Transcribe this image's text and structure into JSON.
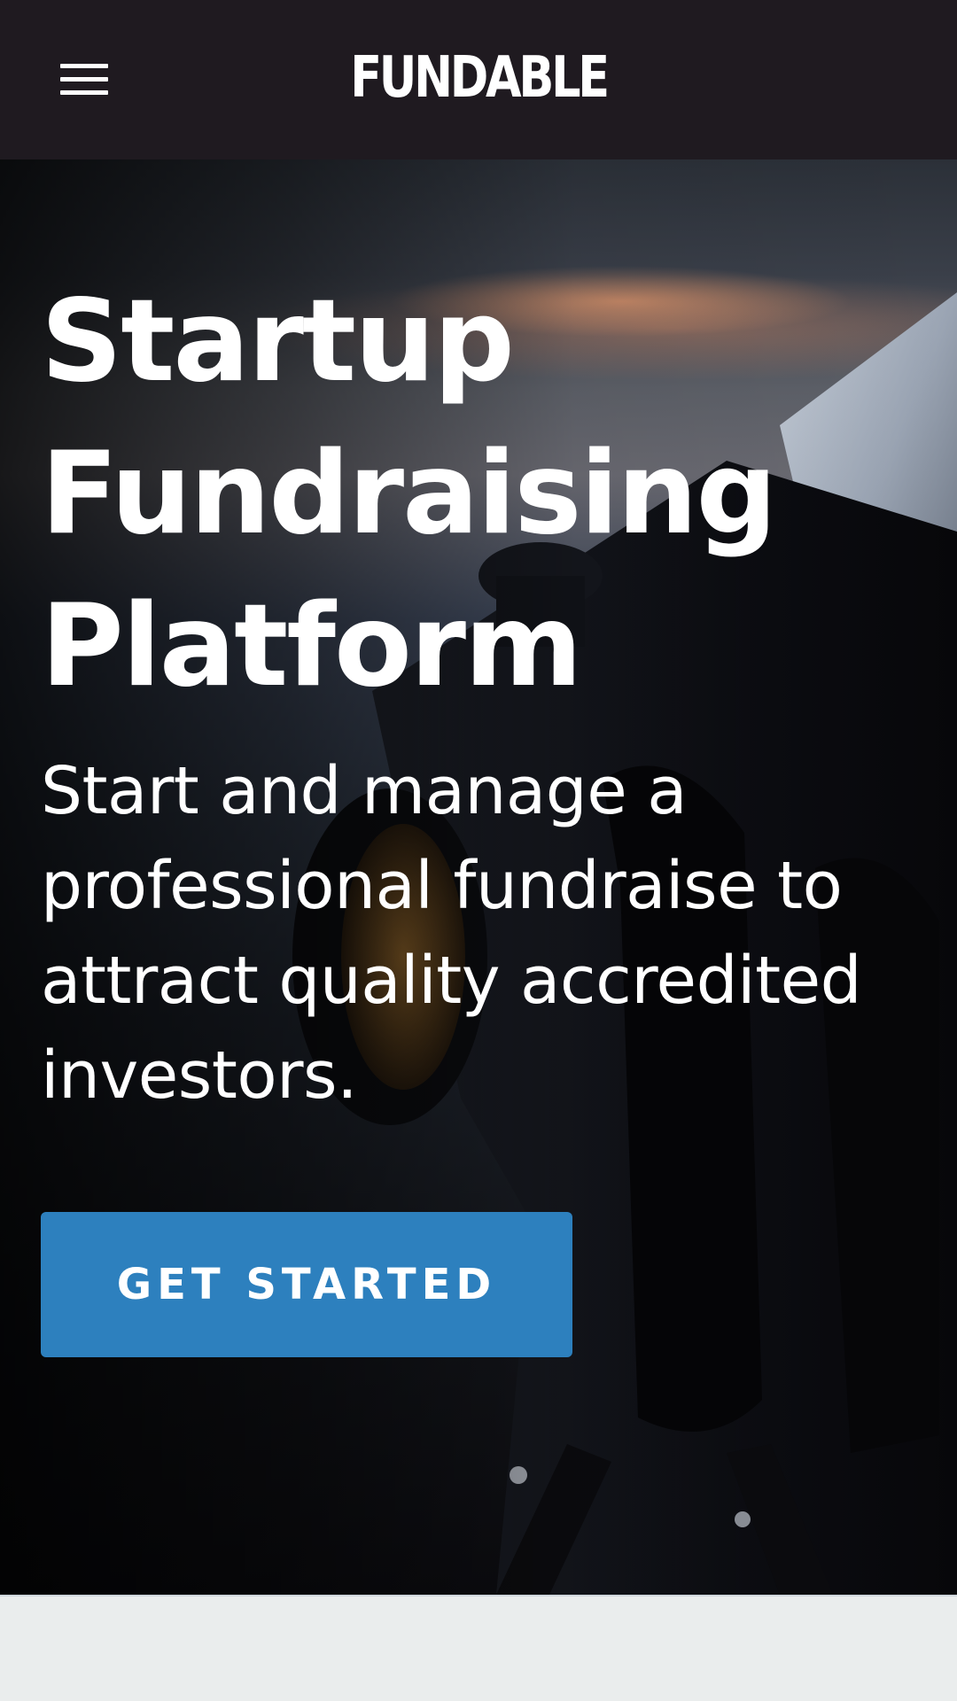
{
  "header": {
    "brand": "FUNDABLE",
    "menu_icon": "hamburger-menu-icon"
  },
  "hero": {
    "title": "Startup Fundraising Platform",
    "subtitle": "Start and manage a professional fundraise to attract quality accredited investors.",
    "cta_label": "GET STARTED",
    "background_image": "telescope-at-dusk-photo"
  },
  "colors": {
    "topbar": "#1f1a20",
    "cta": "#2d80be",
    "page_bg": "#eaeded"
  }
}
